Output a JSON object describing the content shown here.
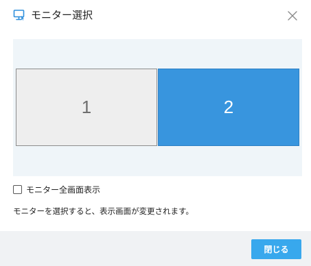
{
  "dialog": {
    "title": "モニター選択",
    "title_icon": "monitor-icon",
    "close_icon": "close-icon",
    "accent_color": "#3895de"
  },
  "monitors": [
    {
      "label": "1",
      "selected": false
    },
    {
      "label": "2",
      "selected": true
    }
  ],
  "options": {
    "fullscreen_label": "モニター全画面表示",
    "fullscreen_checked": false
  },
  "hint_text": "モニターを選択すると、表示画面が変更されます。",
  "footer": {
    "close_label": "閉じる",
    "button_color": "#38a8ed"
  }
}
